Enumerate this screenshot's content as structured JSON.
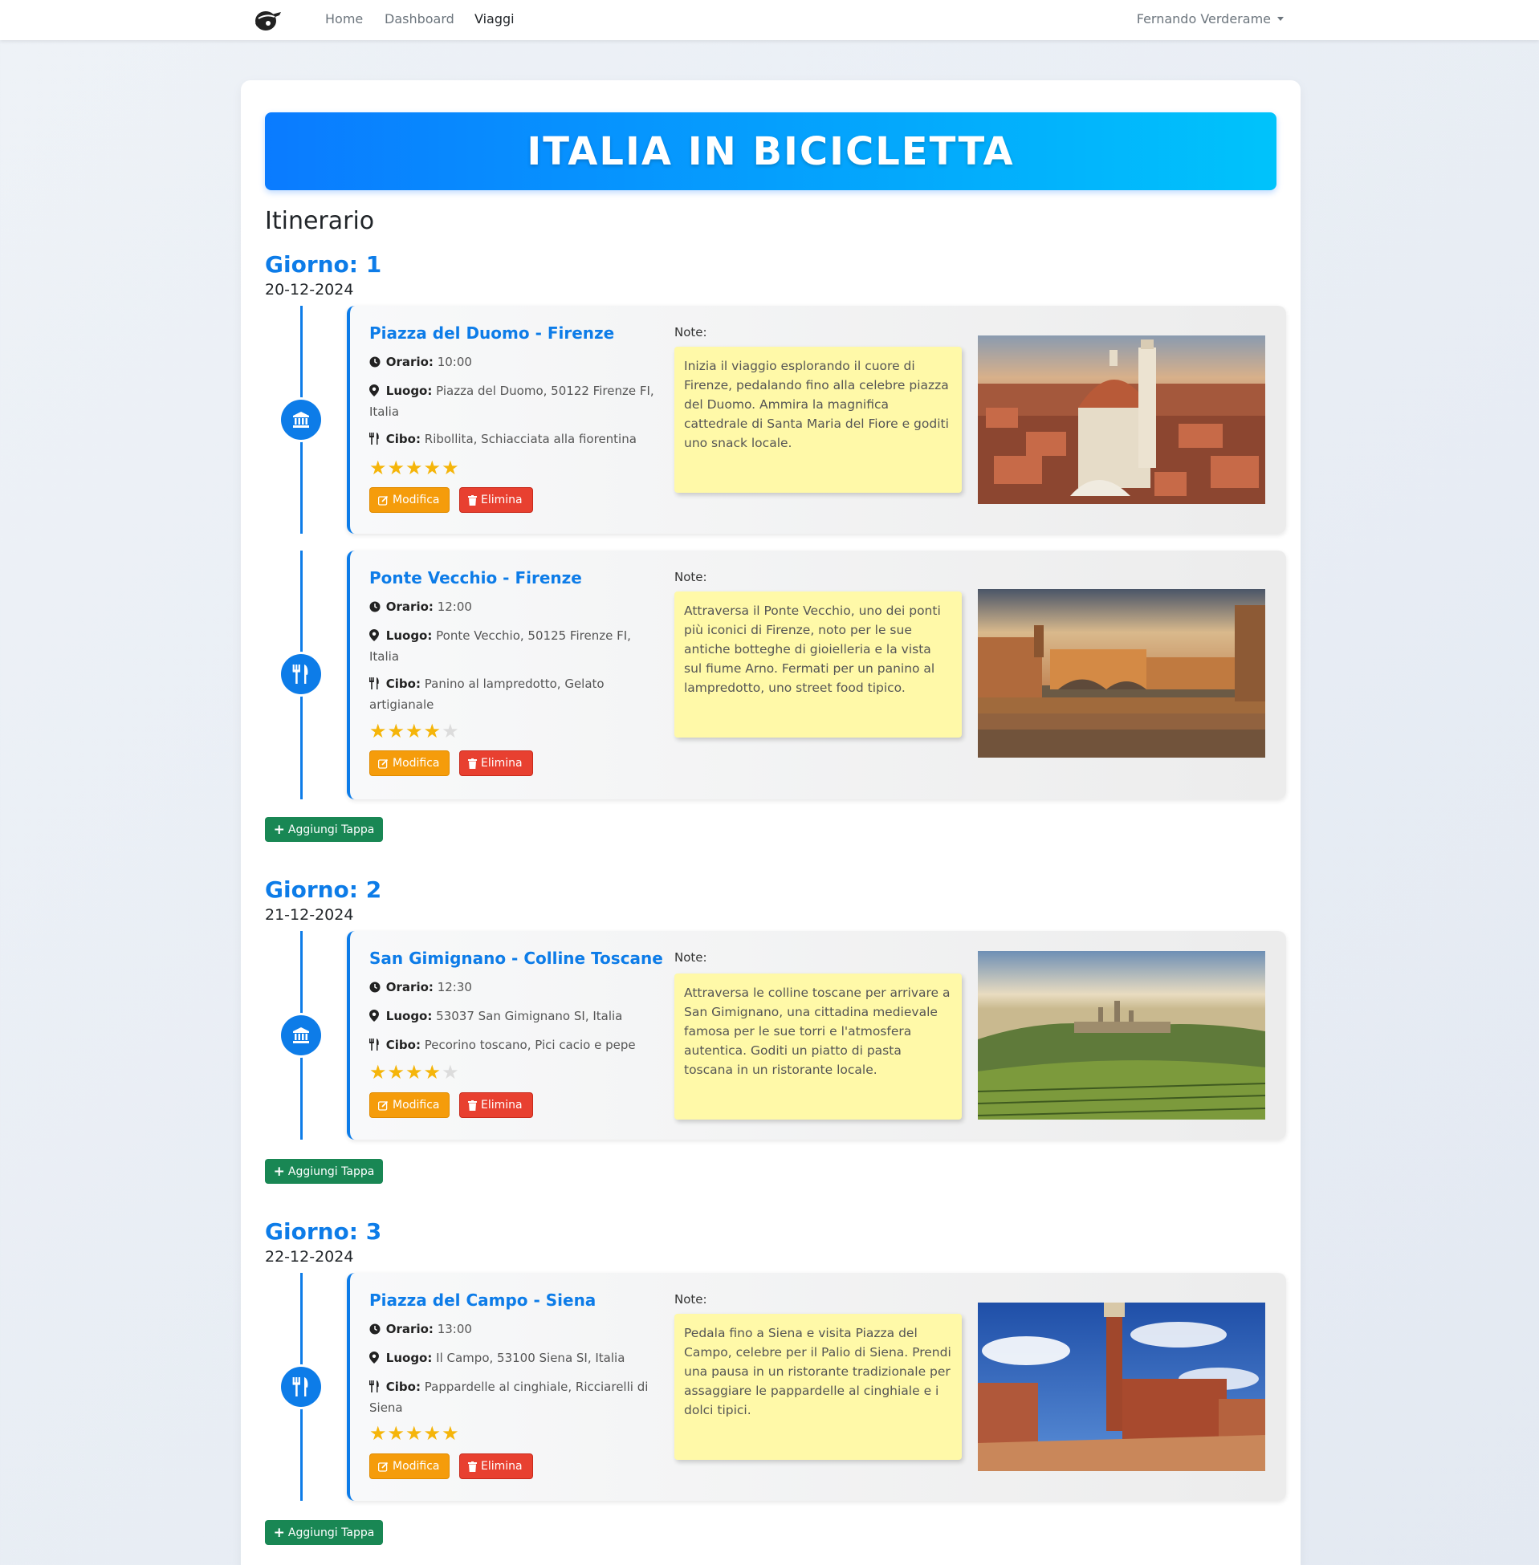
{
  "nav": {
    "links": [
      "Home",
      "Dashboard",
      "Viaggi"
    ],
    "user": "Fernando Verderame"
  },
  "trip_title": "ITALIA IN BICICLETTA",
  "section_title": "Itinerario",
  "labels": {
    "orario": "Orario:",
    "luogo": "Luogo:",
    "cibo": "Cibo:",
    "note": "Note:",
    "edit": "Modifica",
    "delete": "Elimina",
    "add": "Aggiungi Tappa"
  },
  "days": [
    {
      "title": "Giorno: 1",
      "date": "20-12-2024",
      "stops": [
        {
          "name": "Piazza del Duomo - Firenze",
          "icon": "landmark-icon",
          "orario": "10:00",
          "luogo": "Piazza del Duomo, 50122 Firenze FI, Italia",
          "cibo": "Ribollita, Schiacciata alla fiorentina",
          "rating": 5,
          "note": "Inizia il viaggio esplorando il cuore di Firenze, pedalando fino alla celebre piazza del Duomo. Ammira la magnifica cattedrale di Santa Maria del Fiore e goditi uno snack locale."
        },
        {
          "name": "Ponte Vecchio - Firenze",
          "icon": "utensils-icon",
          "orario": "12:00",
          "luogo": "Ponte Vecchio, 50125 Firenze FI, Italia",
          "cibo": "Panino al lampredotto, Gelato artigianale",
          "rating": 4,
          "note": "Attraversa il Ponte Vecchio, uno dei ponti più iconici di Firenze, noto per le sue antiche botteghe di gioielleria e la vista sul fiume Arno. Fermati per un panino al lampredotto, uno street food tipico."
        }
      ]
    },
    {
      "title": "Giorno: 2",
      "date": "21-12-2024",
      "stops": [
        {
          "name": "San Gimignano - Colline Toscane",
          "icon": "landmark-icon",
          "orario": "12:30",
          "luogo": "53037 San Gimignano SI, Italia",
          "cibo": "Pecorino toscano, Pici cacio e pepe",
          "rating": 4,
          "note": "Attraversa le colline toscane per arrivare a San Gimignano, una cittadina medievale famosa per le sue torri e l'atmosfera autentica. Goditi un piatto di pasta toscana in un ristorante locale."
        }
      ]
    },
    {
      "title": "Giorno: 3",
      "date": "22-12-2024",
      "stops": [
        {
          "name": "Piazza del Campo - Siena",
          "icon": "utensils-icon",
          "orario": "13:00",
          "luogo": "Il Campo, 53100 Siena SI, Italia",
          "cibo": "Pappardelle al cinghiale, Ricciarelli di Siena",
          "rating": 5,
          "note": "Pedala fino a Siena e visita Piazza del Campo, celebre per il Palio di Siena. Prendi una pausa in un ristorante tradizionale per assaggiare le pappardelle al cinghiale e i dolci tipici."
        }
      ]
    }
  ]
}
